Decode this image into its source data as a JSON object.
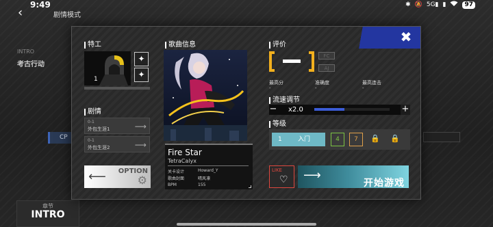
{
  "status_bar": {
    "time": "9:49",
    "icons": [
      "bluetooth-icon",
      "mute-icon",
      "5g-signal-icon",
      "signal-icon",
      "wifi-icon"
    ],
    "battery": "97"
  },
  "background": {
    "title": "剧情模式",
    "intro_en": "INTRO",
    "intro_cn": "考古行动",
    "cp_label": "CP",
    "chapter_label": "章节",
    "chapter_value": "INTRO"
  },
  "dialog": {
    "operator": {
      "title": "特工",
      "level": "1"
    },
    "story": {
      "title": "剧情",
      "items": [
        {
          "code": "0-1",
          "name": "外包生涯1"
        },
        {
          "code": "0-1",
          "name": "外包生涯2"
        }
      ]
    },
    "option": {
      "label": "OPTION"
    },
    "song": {
      "section_title": "歌曲信息",
      "name": "Fire Star",
      "artist": "TetraCalyx",
      "meta": [
        {
          "key": "关卡设计",
          "value": "Howard_Y"
        },
        {
          "key": "歌曲封面",
          "value": "晴风凛"
        },
        {
          "key": "BPM",
          "value": "155"
        }
      ]
    },
    "rating": {
      "title": "评价",
      "tags": [
        "FC",
        "AJ"
      ],
      "stats": [
        {
          "label": "最高分",
          "value": "-"
        },
        {
          "label": "准确度",
          "value": "-"
        },
        {
          "label": "最高连击",
          "value": "-"
        }
      ]
    },
    "speed": {
      "title": "流速调节",
      "value": "x2.0",
      "fill": 0.4
    },
    "level": {
      "title": "等级",
      "selected": {
        "num": "1",
        "name": "入门"
      },
      "others": [
        "4",
        "7"
      ]
    },
    "like": {
      "label": "LIKE"
    },
    "start": {
      "label": "开始游戏"
    }
  },
  "colors": {
    "accent_blue": "#2336a0",
    "grade_gold": "#f2b01e",
    "like_red": "#e0483f",
    "start_cyan": "#7fd4e0",
    "level_selected": "#6fb9c6"
  }
}
